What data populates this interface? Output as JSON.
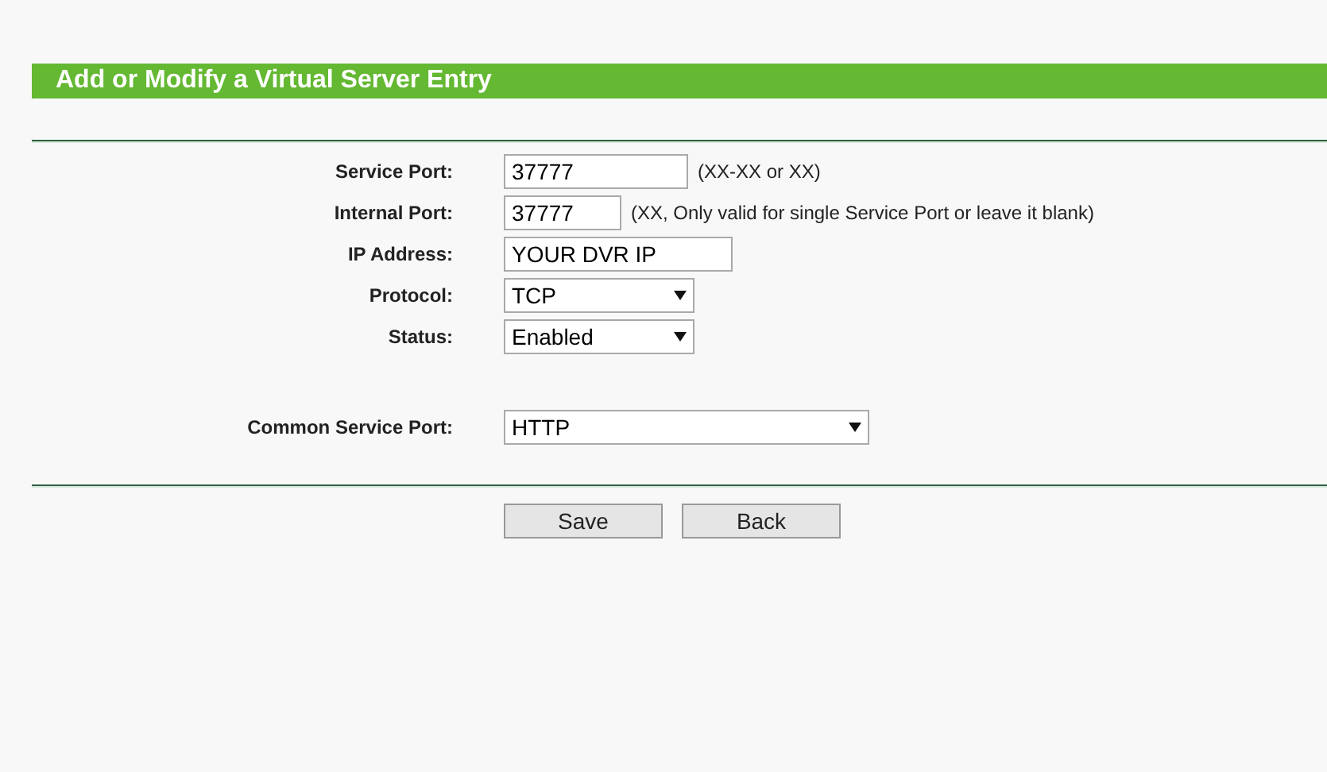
{
  "header": {
    "title": "Add or Modify a Virtual Server Entry"
  },
  "fields": [
    {
      "label": "Service Port:",
      "kind": "input",
      "value": "37777",
      "hint": "(XX-XX or XX)"
    },
    {
      "label": "Internal Port:",
      "kind": "input",
      "value": "37777",
      "hint": "(XX, Only valid for single Service Port or leave it blank)"
    },
    {
      "label": "IP Address:",
      "kind": "input",
      "value": "YOUR DVR IP"
    },
    {
      "label": "Protocol:",
      "kind": "select",
      "value": "TCP"
    },
    {
      "label": "Status:",
      "kind": "select",
      "value": "Enabled"
    }
  ],
  "common_service_port": {
    "label": "Common Service Port:",
    "kind": "select",
    "value": "HTTP"
  },
  "buttons": [
    "Save",
    "Back"
  ]
}
